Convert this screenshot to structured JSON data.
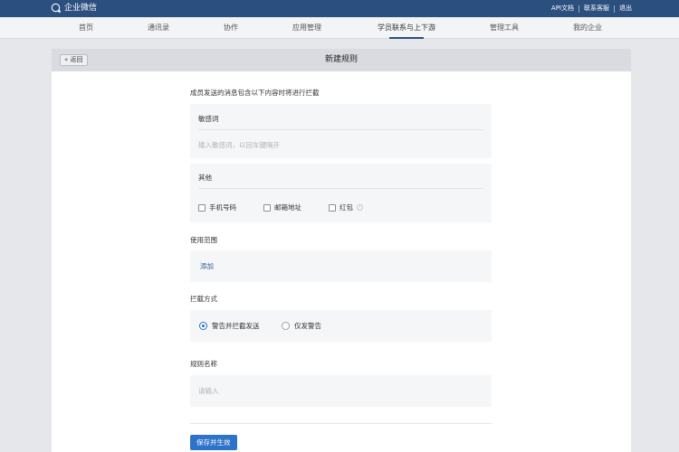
{
  "topbar": {
    "logo_text": "企业微信",
    "links": [
      "API文档",
      "联系客服",
      "退出"
    ]
  },
  "nav": {
    "items": [
      "首页",
      "通讯录",
      "协作",
      "应用管理",
      "学员联系与上下游",
      "管理工具",
      "我的企业"
    ],
    "active_index": 4
  },
  "header": {
    "back_label": "« 返回",
    "title": "新建规则"
  },
  "form": {
    "intro": "成员发送的消息包含以下内容时将进行拦截",
    "sensitive": {
      "label": "敏感词",
      "placeholder": "输入敏感词，以回车键隔开"
    },
    "other": {
      "label": "其他",
      "options": [
        {
          "label": "手机号码",
          "checked": false
        },
        {
          "label": "邮箱地址",
          "checked": false
        },
        {
          "label": "红包",
          "checked": false
        }
      ]
    },
    "scope": {
      "label": "使用范围",
      "add_label": "添加"
    },
    "intercept": {
      "label": "拦截方式",
      "options": [
        {
          "label": "警告并拦截发送",
          "selected": true
        },
        {
          "label": "仅发警告",
          "selected": false
        }
      ]
    },
    "rule_name": {
      "label": "规则名称",
      "placeholder": "请输入"
    },
    "save_label": "保存并生效"
  },
  "colors": {
    "topbar": "#2b4f7e",
    "accent": "#2e73c9",
    "link": "#2b5a8f"
  }
}
